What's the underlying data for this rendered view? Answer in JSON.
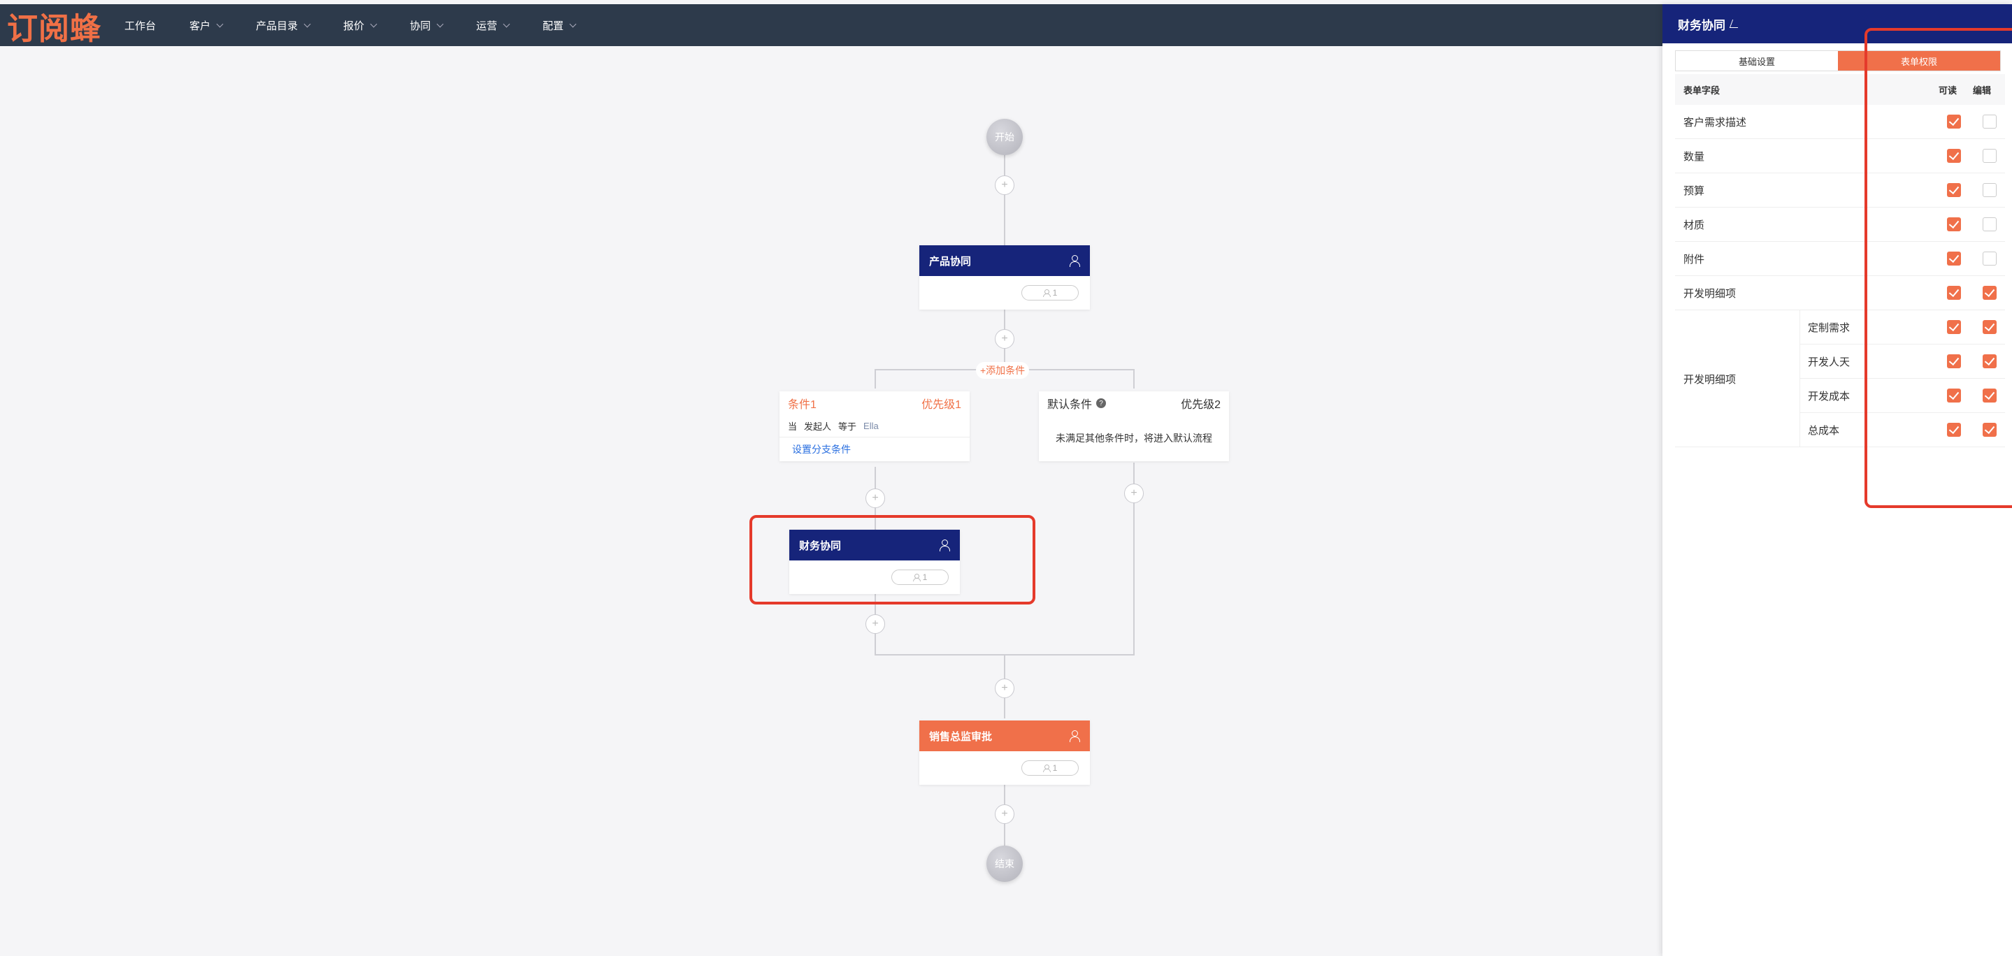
{
  "app": {
    "logo": "订阅蜂"
  },
  "nav": [
    {
      "label": "工作台",
      "dropdown": false
    },
    {
      "label": "客户",
      "dropdown": true
    },
    {
      "label": "产品目录",
      "dropdown": true
    },
    {
      "label": "报价",
      "dropdown": true
    },
    {
      "label": "协同",
      "dropdown": true
    },
    {
      "label": "运营",
      "dropdown": true
    },
    {
      "label": "配置",
      "dropdown": true
    }
  ],
  "flow": {
    "start": "开始",
    "end": "结束",
    "node1": {
      "title": "产品协同",
      "count": "1"
    },
    "add_condition": "+添加条件",
    "branch1": {
      "title": "条件1",
      "priority": "优先级1",
      "when": "当",
      "field": "发起人",
      "op": "等于",
      "value": "Ella",
      "link": "设置分支条件"
    },
    "branch2": {
      "title": "默认条件",
      "priority": "优先级2",
      "desc": "未满足其他条件时，将进入默认流程"
    },
    "node2": {
      "title": "财务协同",
      "count": "1"
    },
    "node3": {
      "title": "销售总监审批",
      "count": "1"
    }
  },
  "panel": {
    "title": "财务协同",
    "tabs": [
      {
        "label": "基础设置",
        "active": false
      },
      {
        "label": "表单权限",
        "active": true
      }
    ],
    "table": {
      "col_field": "表单字段",
      "col_read": "可读",
      "col_edit": "编辑",
      "rows": [
        {
          "field": "客户需求描述",
          "read": true,
          "edit": false
        },
        {
          "field": "数量",
          "read": true,
          "edit": false
        },
        {
          "field": "预算",
          "read": true,
          "edit": false
        },
        {
          "field": "材质",
          "read": true,
          "edit": false
        },
        {
          "field": "附件",
          "read": true,
          "edit": false
        },
        {
          "field": "开发明细项",
          "read": true,
          "edit": true
        }
      ],
      "group": {
        "label": "开发明细项",
        "rows": [
          {
            "field": "定制需求",
            "read": true,
            "edit": true
          },
          {
            "field": "开发人天",
            "read": true,
            "edit": true
          },
          {
            "field": "开发成本",
            "read": true,
            "edit": true
          },
          {
            "field": "总成本",
            "read": true,
            "edit": true
          }
        ]
      }
    }
  },
  "colors": {
    "navy": "#16247a",
    "accent": "#f0704a",
    "topbar": "#2d3a4b",
    "highlight": "#e53a2b"
  }
}
